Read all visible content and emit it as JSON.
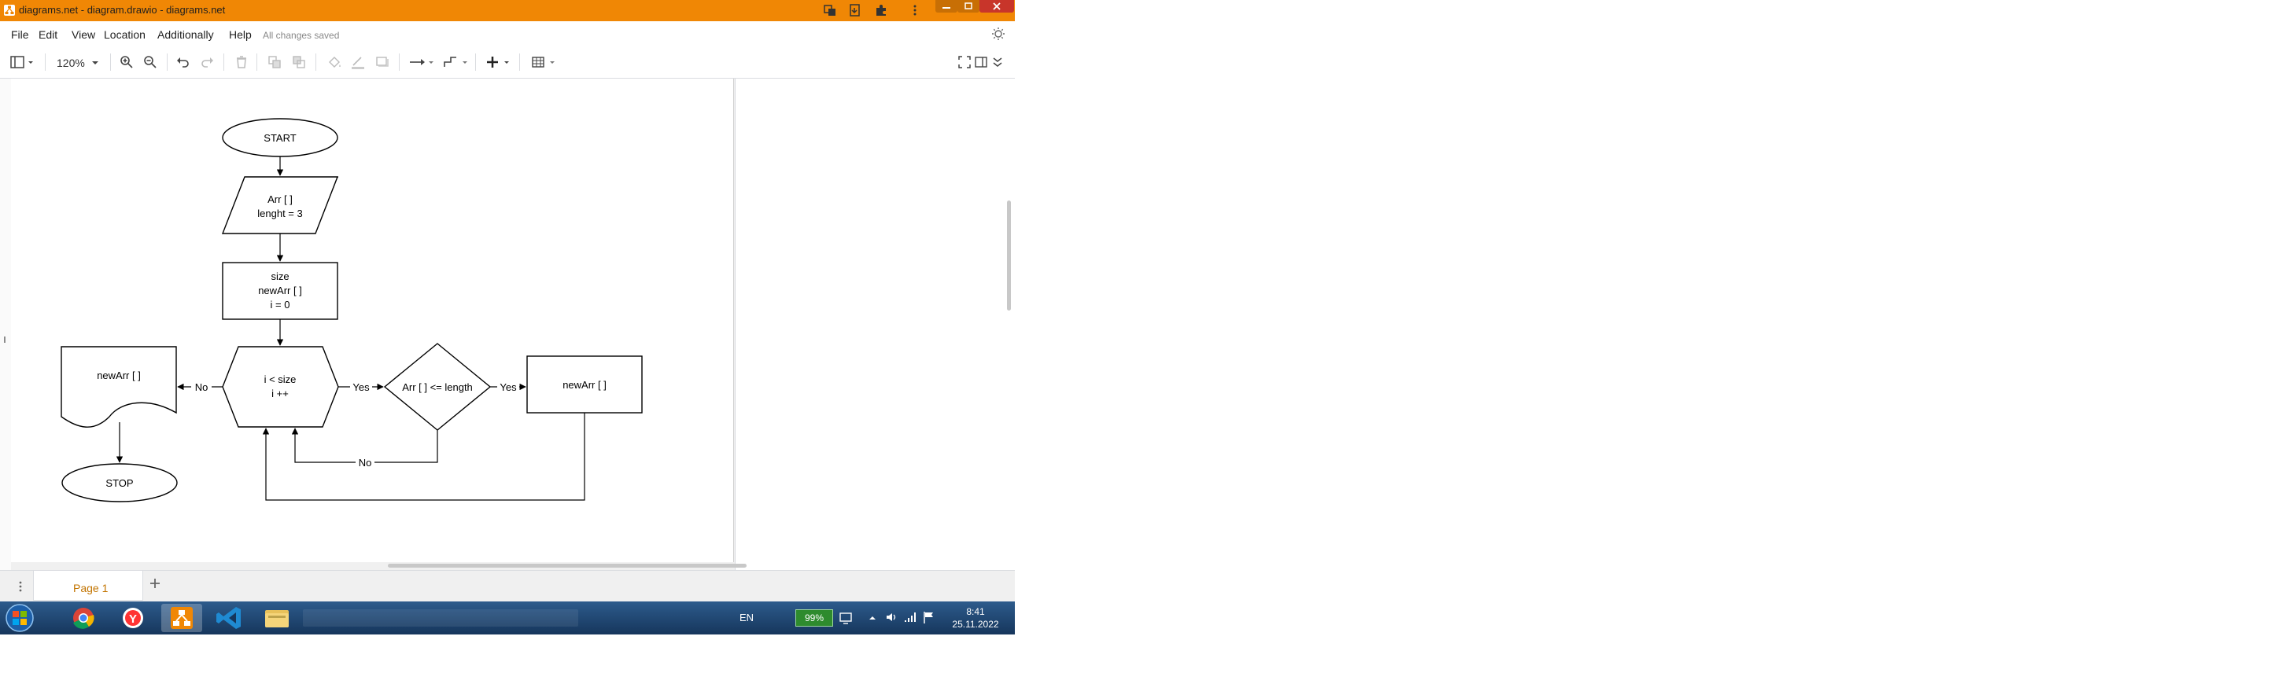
{
  "window": {
    "title": "diagrams.net - diagram.drawio - diagrams.net",
    "accent": "#f08705"
  },
  "menu": {
    "file": "File",
    "edit": "Edit",
    "view": "View",
    "location": "Location",
    "additionally": "Additionally",
    "help": "Help",
    "status": "All changes saved"
  },
  "toolbar": {
    "zoom": "120%"
  },
  "diagram": {
    "start": "START",
    "input_line1": "Arr [ ]",
    "input_line2": "lenght = 3",
    "init_line1": "size",
    "init_line2": "newArr [ ]",
    "init_line3": "i = 0",
    "loop_line1": "i < size",
    "loop_line2": "i ++",
    "condition": "Arr [ ] <= length",
    "assign": "newArr [ ]",
    "output": "newArr [ ]",
    "stop": "STOP",
    "edge_no_left": "No",
    "edge_yes_1": "Yes",
    "edge_yes_2": "Yes",
    "edge_no_bottom": "No"
  },
  "pages": {
    "active": "Page 1"
  },
  "taskbar": {
    "lang": "EN",
    "battery": "99%",
    "time": "8:41",
    "date": "25.11.2022"
  }
}
